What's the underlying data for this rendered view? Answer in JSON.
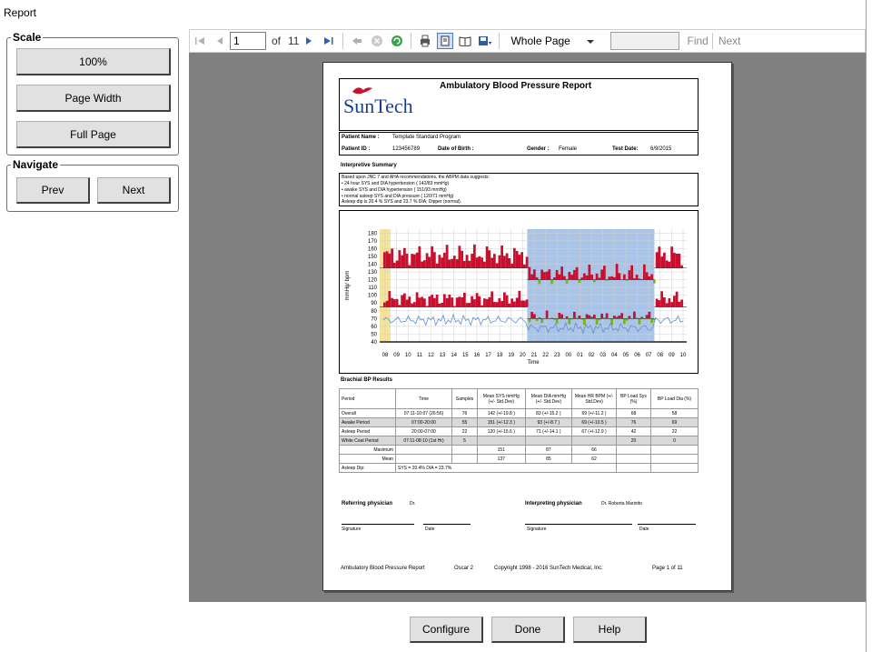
{
  "window": {
    "title": "Report"
  },
  "scale": {
    "legend": "Scale",
    "buttons": [
      "100%",
      "Page Width",
      "Full Page"
    ]
  },
  "navigate": {
    "legend": "Navigate",
    "prev": "Prev",
    "next": "Next"
  },
  "toolbar": {
    "page_value": "1",
    "of_label": "of",
    "total_pages": "11",
    "zoom_value": "Whole Page",
    "find_label": "Find",
    "next_label": "Next"
  },
  "report": {
    "title": "Ambulatory Blood Pressure Report",
    "logo_text": "SunTech",
    "patient_name_label": "Patient Name :",
    "patient_name": "Template Standard Program",
    "patient_id_label": "Patient ID :",
    "patient_id": "123456789",
    "dob_label": "Date of Birth :",
    "gender_label": "Gender :",
    "gender": "Female",
    "test_date_label": "Test Date:",
    "test_date": "6/9/2015",
    "summary_heading": "Interpretive Summary",
    "summary_lines": [
      "Based upon JNC 7 and AHA recommendations, the ABPM data suggests:",
      "• 24 hour SYS and DIA hypertension ( 142/83 mmHg)",
      "• awake SYS and DIA hypertension ( 151/93 mmHg)",
      "• normal asleep SYS and DIA pressure ( 120/71 mmHg)",
      "Asleep dip is 20.4 % SYS and 23.7 % DIA; Dipper (normal)."
    ],
    "chart_ylabel": "mmHg/ bpm",
    "chart_xlabel": "Time",
    "results_heading": "Brachial BP Results",
    "table_headers": [
      "Period",
      "Time",
      "Samples",
      "Mean SYS mmHg (+/- Std.Dev)",
      "Mean DIA mmHg (+/- Std.Dev)",
      "Mean HR BPM (+/- Std.Dev)",
      "BP Load Sys (%)",
      "BP Load Dia (%)"
    ],
    "table_rows": [
      [
        "Overall",
        "07:11-10:07 (26:56)",
        "76",
        "142 (+/-19.8 )",
        "83 (+/-15.2 )",
        "69 (+/-11.2 )",
        "68",
        "58"
      ],
      [
        "Awake Period",
        "07:00-20:00",
        "55",
        "151 (+/-12.3 )",
        "93 (+/-8.7 )",
        "69 (+/-10.5 )",
        "76",
        "69"
      ],
      [
        "Asleep Period",
        "20:00-07:00",
        "22",
        "120 (+/-15.6 )",
        "71 (+/-14.1 )",
        "67 (+/-12.9 )",
        "42",
        "22"
      ],
      [
        "White Coat Period",
        "07:11-08:10 (1st Hr)",
        "5",
        "",
        "",
        "",
        "20",
        "0"
      ],
      [
        "Maximum",
        "",
        "",
        "151",
        "87",
        "66",
        "",
        ""
      ],
      [
        "Mean",
        "",
        "",
        "137",
        "85",
        "62",
        "",
        ""
      ],
      [
        "Asleep Dip:",
        "SYS = 20.4%  DIA = 23.7%",
        "",
        "",
        "",
        "",
        "",
        ""
      ]
    ],
    "referring_label": "Referring physician",
    "referring_name": "Dr.",
    "interpreting_label": "Interpreting physician",
    "interpreting_name": "Dr. Roberta Mariotto",
    "signature_label": "Signature",
    "date_label": "Date",
    "footer_left": "Ambulatory Blood Pressure Report",
    "footer_version": "Oscar 2",
    "footer_copyright": "Copyright 1998 - 2016 SunTech Medical, Inc.",
    "footer_page": "Page 1 of 11"
  },
  "chart_data": {
    "type": "line",
    "ylim": [
      40,
      185
    ],
    "yticks": [
      "180",
      "170",
      "160",
      "150",
      "140",
      "130",
      "120",
      "110",
      "100",
      "90",
      "80",
      "70",
      "60",
      "50",
      "40"
    ],
    "xticks": [
      "08",
      "09",
      "10",
      "11",
      "12",
      "13",
      "14",
      "15",
      "16",
      "17",
      "18",
      "19",
      "20",
      "21",
      "22",
      "23",
      "00",
      "01",
      "02",
      "03",
      "04",
      "05",
      "06",
      "07",
      "08",
      "09",
      "10"
    ],
    "xlabel": "Time",
    "ylabel": "mmHg/ bpm",
    "series": [],
    "colors": {
      "above": "#c8102e",
      "below": "#7ab317",
      "hr": "#5b8fd0",
      "asleep": "#a9c4e6",
      "whitecoat": "#f6e39a"
    }
  },
  "bottom": {
    "configure": "Configure",
    "done": "Done",
    "help": "Help"
  }
}
